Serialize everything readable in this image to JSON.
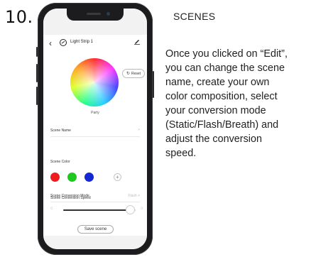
{
  "step_number": "10.",
  "phone": {
    "header": {
      "back_icon": "‹",
      "strip_icon": "light-strip-icon",
      "title": "Light Strip 1",
      "edit_icon": "pencil-icon"
    },
    "color_wheel": {
      "reset_label": "Reset",
      "reset_icon": "↻",
      "scene_label": "Party"
    },
    "scene_name": {
      "label": "Scene Name",
      "chevron": ">"
    },
    "scene_color": {
      "label": "Scene Color",
      "colors": [
        "#ee1c1c",
        "#1ec81e",
        "#1428d2"
      ],
      "add_label": "+"
    },
    "conversion_mode": {
      "label": "Scene Conversion Mode",
      "value": "Flash  >"
    },
    "conversion_speed": {
      "label": "Scene Conversion Speed",
      "slow_icon": "◌",
      "fast_icon": "◌",
      "value_fraction": 0.93
    },
    "save_label": "Save scene"
  },
  "instructions": {
    "heading": "SCENES",
    "lines": [
      "Once you clicked on “Edit”,",
      "you can change the scene",
      "name, create your own",
      "color composition, select",
      "your conversion mode",
      "(Static/Flash/Breath) and",
      "adjust the conversion",
      "speed."
    ]
  }
}
